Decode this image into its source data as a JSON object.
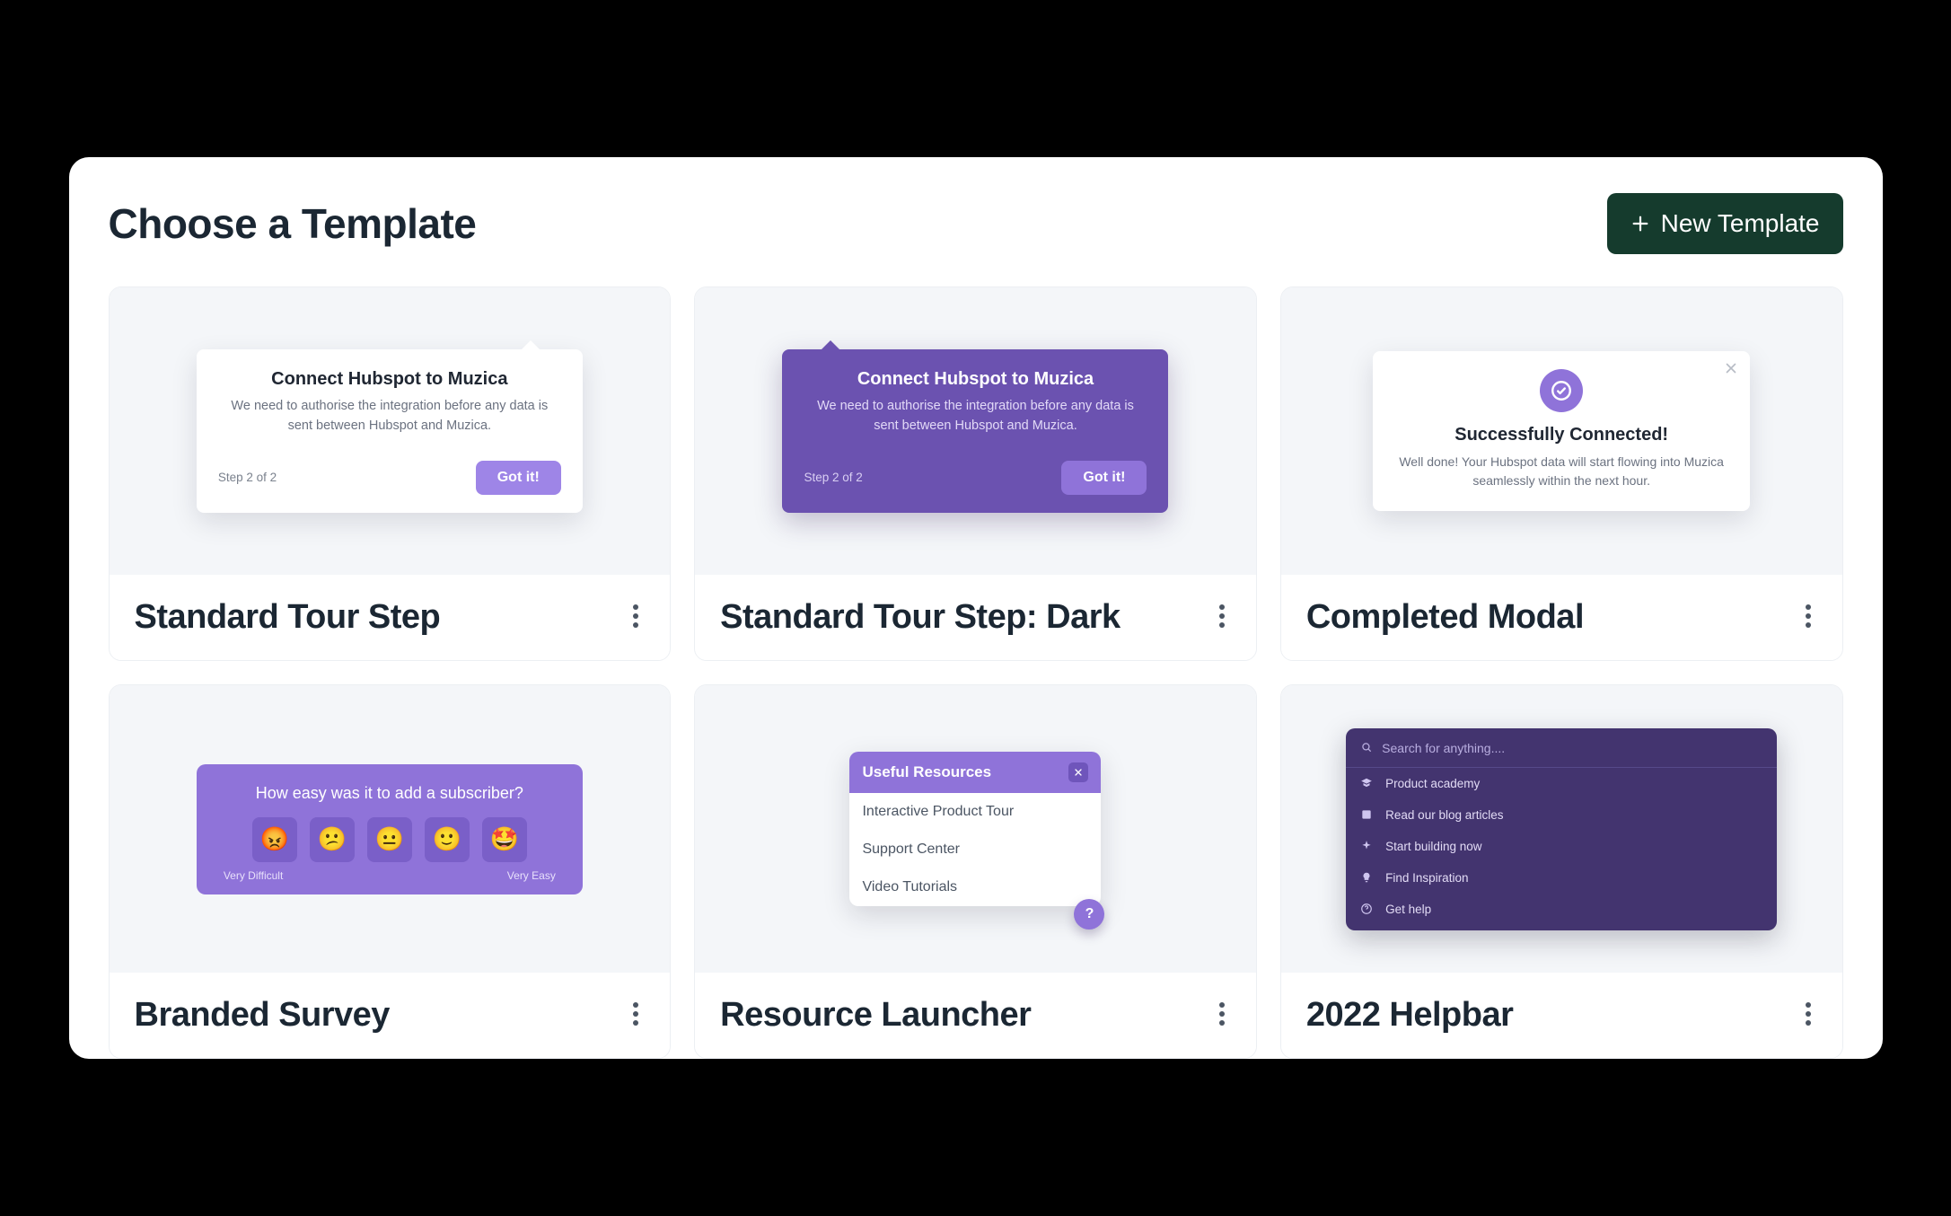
{
  "header": {
    "title": "Choose a Template",
    "new_button_label": "New Template"
  },
  "colors": {
    "button_bg": "#153b2d",
    "accent_purple": "#8f73d9",
    "accent_purple_dark": "#6b52b0",
    "card_border": "#eceff3",
    "preview_bg": "#f4f6f9"
  },
  "cards": [
    {
      "id": "standard_tour_step",
      "title": "Standard Tour Step",
      "preview": {
        "heading": "Connect Hubspot to Muzica",
        "body": "We need to authorise the integration before any data is sent between Hubspot and Muzica.",
        "step_label": "Step 2 of 2",
        "cta": "Got it!"
      }
    },
    {
      "id": "standard_tour_step_dark",
      "title": "Standard Tour Step: Dark",
      "preview": {
        "heading": "Connect Hubspot to Muzica",
        "body": "We need to authorise the integration before any data is sent between Hubspot and Muzica.",
        "step_label": "Step 2 of 2",
        "cta": "Got it!"
      }
    },
    {
      "id": "completed_modal",
      "title": "Completed Modal",
      "preview": {
        "heading": "Successfully Connected!",
        "body": "Well done! Your Hubspot data will start flowing into Muzica seamlessly within the next hour."
      }
    },
    {
      "id": "branded_survey",
      "title": "Branded Survey",
      "preview": {
        "question": "How easy was it to add a subscriber?",
        "left_label": "Very Difficult",
        "right_label": "Very Easy",
        "emojis": [
          "😡",
          "😕",
          "😐",
          "🙂",
          "🤩"
        ]
      }
    },
    {
      "id": "resource_launcher",
      "title": "Resource Launcher",
      "preview": {
        "heading": "Useful Resources",
        "items": [
          "Interactive Product Tour",
          "Support Center",
          "Video Tutorials"
        ]
      }
    },
    {
      "id": "helpbar_2022",
      "title": "2022 Helpbar",
      "preview": {
        "search_placeholder": "Search for anything....",
        "rows": [
          {
            "icon": "academy",
            "label": "Product academy"
          },
          {
            "icon": "blog",
            "label": "Read our blog articles"
          },
          {
            "icon": "build",
            "label": "Start building now"
          },
          {
            "icon": "bulb",
            "label": "Find Inspiration"
          },
          {
            "icon": "help",
            "label": "Get help"
          }
        ]
      }
    }
  ]
}
